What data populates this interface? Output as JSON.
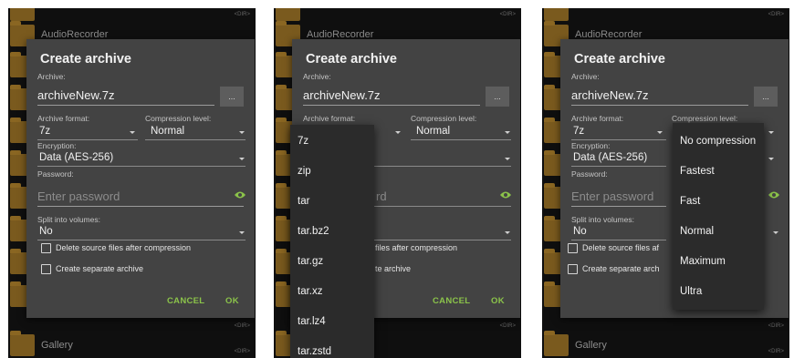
{
  "background": {
    "top_folder": "AudioRecorder",
    "bottom_folder": "Gallery",
    "dir_tag": "<DIR>"
  },
  "dialog": {
    "title": "Create archive",
    "archive_label": "Archive:",
    "archive_value": "archiveNew.7z",
    "browse_label": "...",
    "format_label": "Archive format:",
    "format_value": "7z",
    "level_label": "Compression level:",
    "level_value": "Normal",
    "encryption_label": "Encryption:",
    "encryption_value": "Data (AES-256)",
    "password_label": "Password:",
    "password_placeholder": "Enter password",
    "split_label": "Split into volumes:",
    "split_value": "No",
    "delete_label": "Delete source files after compression",
    "separate_label": "Create separate archive",
    "cancel_label": "CANCEL",
    "ok_label": "OK"
  },
  "format_menu": [
    "7z",
    "zip",
    "tar",
    "tar.bz2",
    "tar.gz",
    "tar.xz",
    "tar.lz4",
    "tar.zstd"
  ],
  "level_menu": [
    "No compression",
    "Fastest",
    "Fast",
    "Normal",
    "Maximum",
    "Ultra"
  ],
  "partial": {
    "p2_password_tail": "rd",
    "p2_delete_tail": "files after compression",
    "p2_separate_tail": "te archive",
    "p3_delete_head": "Delete source files af",
    "p3_separate_head": "Create separate arch"
  },
  "colors": {
    "accent": "#8bc34a",
    "dialog": "#434343",
    "menu": "#2b2b2b"
  }
}
